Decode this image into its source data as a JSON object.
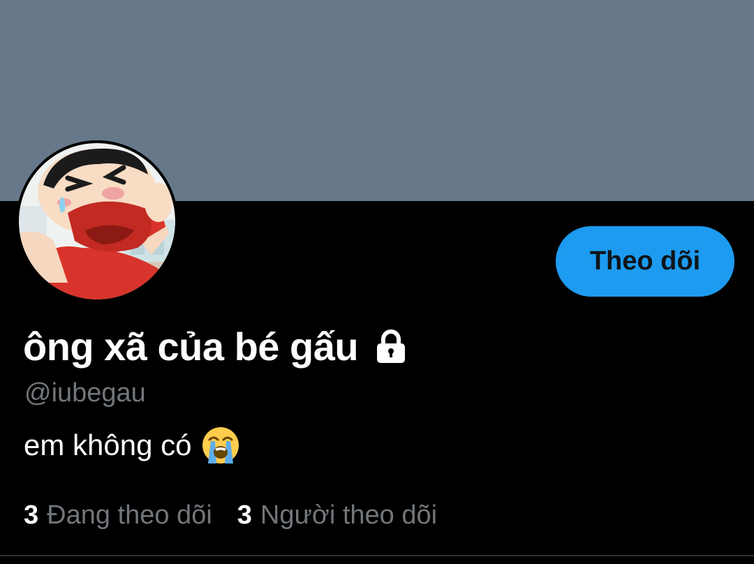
{
  "profile": {
    "display_name": "ông xã của bé gấu",
    "handle": "@iubegau",
    "bio": "em không có",
    "bio_emoji": "loudly-crying-face-emoji",
    "protected_icon": "lock-icon"
  },
  "actions": {
    "follow_label": "Theo dõi"
  },
  "stats": {
    "following_count": "3",
    "following_label": "Đang theo dõi",
    "followers_count": "3",
    "followers_label": "Người theo dõi"
  },
  "colors": {
    "banner": "#66788a",
    "background": "#000000",
    "accent": "#1d9bf0",
    "secondary_text": "#71767b"
  }
}
